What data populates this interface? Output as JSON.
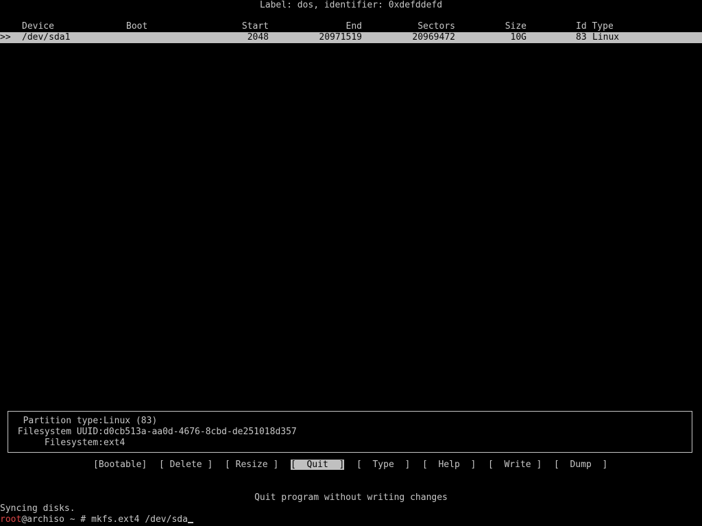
{
  "disklabel": "Label: dos, identifier: 0xdefddefd",
  "table": {
    "headers": {
      "device": "Device",
      "boot": "Boot",
      "start": "Start",
      "end": "End",
      "sectors": "Sectors",
      "size": "Size",
      "id_type": "Id Type"
    },
    "rows": [
      {
        "marker": ">>",
        "device": "/dev/sda1",
        "boot": "",
        "start": "2048",
        "end": "20971519",
        "sectors": "20969472",
        "size": "10G",
        "id": "83",
        "type": "Linux"
      }
    ]
  },
  "info": {
    "partition_type_label": "Partition type:",
    "partition_type_value": "Linux (83)",
    "fs_uuid_label": "Filesystem UUID:",
    "fs_uuid_value": "d0cb513a-aa0d-4676-8cbd-de251018d357",
    "filesystem_label": "Filesystem:",
    "filesystem_value": "ext4"
  },
  "menu": [
    {
      "label": "[Bootable]",
      "selected": false
    },
    {
      "label": "[ Delete ]",
      "selected": false
    },
    {
      "label": "[ Resize ]",
      "selected": false
    },
    {
      "label": "[  Quit  ]",
      "selected": true
    },
    {
      "label": "[  Type  ]",
      "selected": false
    },
    {
      "label": "[  Help  ]",
      "selected": false
    },
    {
      "label": "[  Write ]",
      "selected": false
    },
    {
      "label": "[  Dump  ]",
      "selected": false
    }
  ],
  "menu_hint": "Quit program without writing changes",
  "console": {
    "syncing": "Syncing disks.",
    "prompt_user": "root",
    "prompt_rest": "@archiso ~ # ",
    "command": "mkfs.ext4 /dev/sda"
  }
}
